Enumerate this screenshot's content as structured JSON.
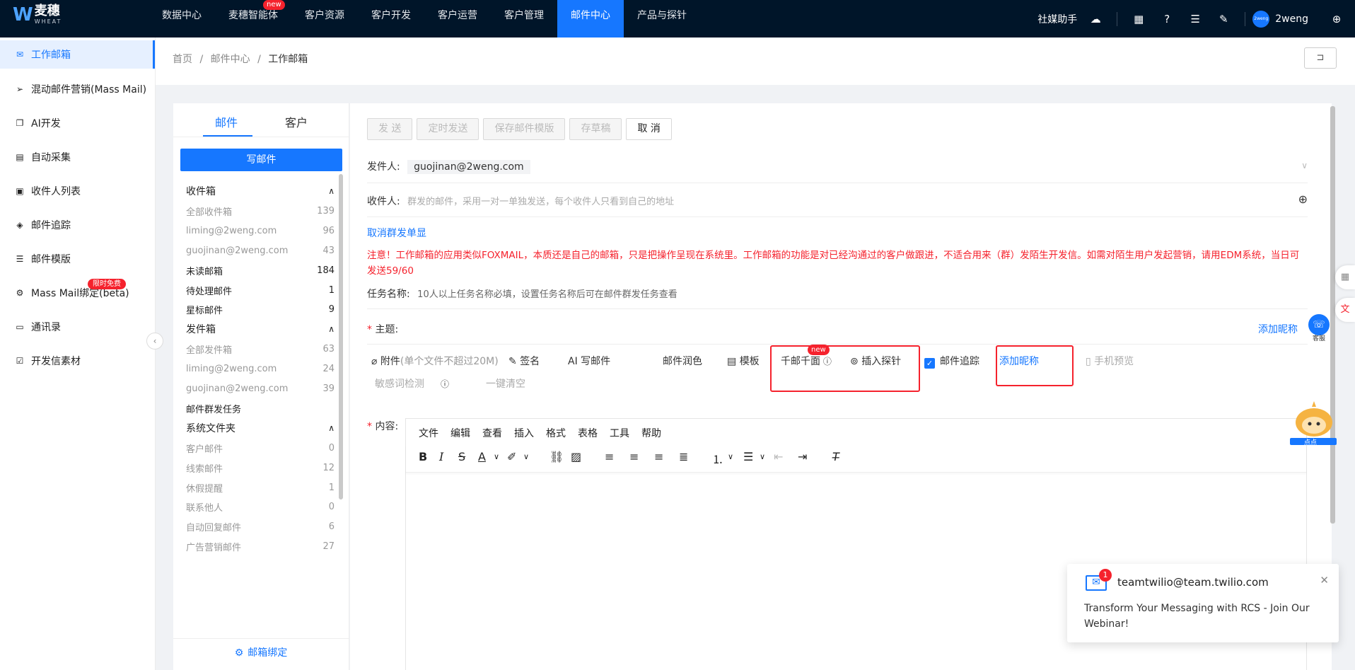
{
  "app": {
    "logo_cn": "麦穗",
    "logo_en": "WHEAT",
    "logo_mark": "W"
  },
  "nav": {
    "items": [
      {
        "label": "数据中心"
      },
      {
        "label": "麦穗智能体",
        "badge": "new"
      },
      {
        "label": "客户资源"
      },
      {
        "label": "客户开发"
      },
      {
        "label": "客户运营"
      },
      {
        "label": "客户管理"
      },
      {
        "label": "邮件中心",
        "active": true
      },
      {
        "label": "产品与探针"
      }
    ]
  },
  "topright": {
    "assistant_label": "社媒助手",
    "username": "2weng",
    "avatar_text": "2weng",
    "icons": [
      "cloud-upload-icon",
      "apps-grid-icon",
      "help-icon",
      "checklist-icon",
      "edit-task-icon",
      "globe-icon"
    ]
  },
  "sidebar": {
    "items": [
      {
        "label": "工作邮箱",
        "icon": "mail-icon",
        "active": true
      },
      {
        "label": "混动邮件营销(Mass Mail)",
        "icon": "send-icon"
      },
      {
        "label": "AI开发",
        "icon": "copy-icon"
      },
      {
        "label": "自动采集",
        "icon": "doc-search-icon"
      },
      {
        "label": "收件人列表",
        "icon": "contact-card-icon"
      },
      {
        "label": "邮件追踪",
        "icon": "target-icon"
      },
      {
        "label": "邮件模版",
        "icon": "list-icon"
      },
      {
        "label": "Mass Mail绑定(beta)",
        "icon": "settings-icon",
        "badge": "限时免费"
      },
      {
        "label": "通讯录",
        "icon": "address-book-icon"
      },
      {
        "label": "开发信素材",
        "icon": "calendar-check-icon"
      }
    ]
  },
  "breadcrumb": {
    "items": [
      "首页",
      "邮件中心",
      "工作邮箱"
    ],
    "separator": "/"
  },
  "mailbox": {
    "tabs": [
      "邮件",
      "客户"
    ],
    "compose_label": "写邮件",
    "folders": [
      {
        "label": "收件箱",
        "type": "head",
        "count": ""
      },
      {
        "label": "全部收件箱",
        "type": "sub",
        "count": "139"
      },
      {
        "label": "liming@2weng.com",
        "type": "sub",
        "count": "96"
      },
      {
        "label": "guojinan@2weng.com",
        "type": "sub",
        "count": "43"
      },
      {
        "label": "未读邮箱",
        "type": "main",
        "count": "184"
      },
      {
        "label": "待处理邮件",
        "type": "main",
        "count": "1"
      },
      {
        "label": "星标邮件",
        "type": "main",
        "count": "9"
      },
      {
        "label": "发件箱",
        "type": "head",
        "count": ""
      },
      {
        "label": "全部发件箱",
        "type": "sub",
        "count": "63"
      },
      {
        "label": "liming@2weng.com",
        "type": "sub",
        "count": "24"
      },
      {
        "label": "guojinan@2weng.com",
        "type": "sub",
        "count": "39"
      },
      {
        "label": "邮件群发任务",
        "type": "main",
        "count": ""
      },
      {
        "label": "系统文件夹",
        "type": "head",
        "count": ""
      },
      {
        "label": "客户邮件",
        "type": "sub",
        "count": "0"
      },
      {
        "label": "线索邮件",
        "type": "sub",
        "count": "12"
      },
      {
        "label": "休假提醒",
        "type": "sub",
        "count": "1"
      },
      {
        "label": "联系他人",
        "type": "sub",
        "count": "0"
      },
      {
        "label": "自动回复邮件",
        "type": "sub",
        "count": "6"
      },
      {
        "label": "广告营销邮件",
        "type": "sub",
        "count": "27"
      }
    ],
    "bind_label": "邮箱绑定"
  },
  "editor": {
    "buttons": {
      "send": "发 送",
      "schedule": "定时发送",
      "save_template": "保存邮件模版",
      "draft": "存草稿",
      "cancel": "取 消"
    },
    "sender_label": "发件人:",
    "sender_value": "guojinan@2weng.com",
    "recipient_label": "收件人:",
    "recipient_placeholder": "群发的邮件，采用一对一单独发送，每个收件人只看到自己的地址",
    "cancel_bulk_link": "取消群发单显",
    "warning": "注意！工作邮箱的应用类似FOXMAIL，本质还是自己的邮箱，只是把操作呈现在系统里。工作邮箱的功能是对已经沟通过的客户做跟进，不适合用来（群）发陌生开发信。如需对陌生用户发起营销，请用EDM系统，当日可发送59/60",
    "task_label": "任务名称:",
    "task_placeholder": "10人以上任务名称必填，设置任务名称后可在邮件群发任务查看",
    "subject_required": "*",
    "subject_label": "主题:",
    "add_nickname_link": "添加昵称",
    "toolbar": {
      "attachment": "附件",
      "attachment_hint": "(单个文件不超过20M)",
      "signature": "签名",
      "ai_write": "AI 写邮件",
      "polish": "邮件润色",
      "template": "模板",
      "personalize": "千邮千面",
      "personalize_badge": "new",
      "insert_probe": "插入探针",
      "tracking": "邮件追踪",
      "tracking_checked": true,
      "add_nickname": "添加昵称",
      "mobile_preview": "手机预览",
      "sensitive_check": "敏感词检测",
      "clear_all": "一键清空"
    },
    "content_label": "内容:",
    "rte_menu": [
      "文件",
      "编辑",
      "查看",
      "插入",
      "格式",
      "表格",
      "工具",
      "帮助"
    ]
  },
  "float": {
    "service_label": "客服",
    "mascot_label": "点点"
  },
  "toast": {
    "badge": "1",
    "from": "teamtwilio@team.twilio.com",
    "body": "Transform Your Messaging with RCS - Join Our Webinar!"
  },
  "colors": {
    "primary": "#1677ff",
    "danger": "#f5222d",
    "topbar": "#001529"
  }
}
